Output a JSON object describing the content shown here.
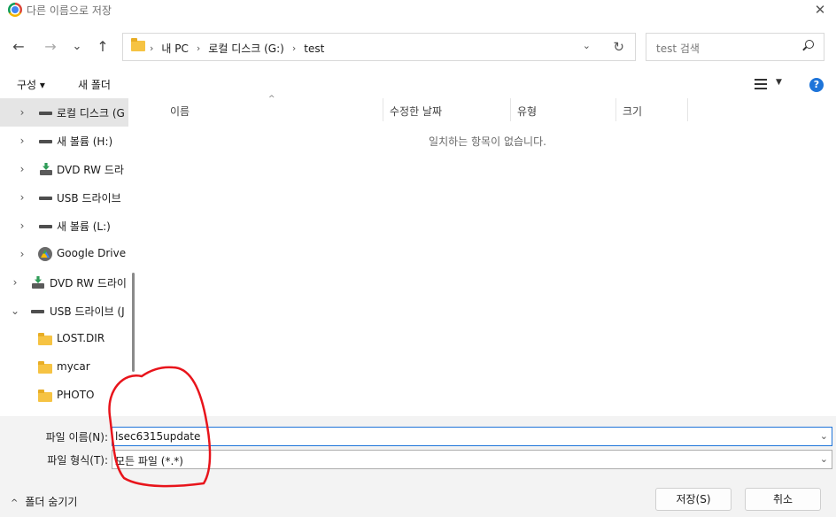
{
  "window": {
    "title": "다른 이름으로 저장",
    "close_glyph": "✕"
  },
  "toolbar": {
    "back_glyph": "←",
    "forward_glyph": "→",
    "recent_glyph": "⌄",
    "up_glyph": "↑"
  },
  "address": {
    "crumbs": [
      "내 PC",
      "로컬 디스크 (G:)",
      "test"
    ],
    "separator": "›",
    "dropdown_glyph": "⌄",
    "refresh_glyph": "↻"
  },
  "search": {
    "placeholder": "test 검색"
  },
  "commandbar": {
    "organize": "구성 ▾",
    "new_folder": "새 폴더",
    "help": "?"
  },
  "sidebar": {
    "items": [
      {
        "label": "로컬 디스크 (G",
        "icon": "drive-icon",
        "chevron": "›",
        "selected": true
      },
      {
        "label": "새 볼륨 (H:)",
        "icon": "drive-icon",
        "chevron": "›"
      },
      {
        "label": "DVD RW 드라",
        "icon": "dvd-icon",
        "chevron": "›"
      },
      {
        "label": "USB 드라이브",
        "icon": "drive-icon",
        "chevron": "›"
      },
      {
        "label": "새 볼륨 (L:)",
        "icon": "drive-icon",
        "chevron": "›"
      },
      {
        "label": "Google Drive (",
        "icon": "gdrive-icon",
        "chevron": "›"
      },
      {
        "label": "DVD RW 드라이",
        "icon": "dvd-icon",
        "chevron": "›"
      },
      {
        "label": "USB 드라이브 (J",
        "icon": "drive-icon",
        "chevron": "⌄"
      },
      {
        "label": "LOST.DIR",
        "icon": "folder-icon",
        "chevron": ""
      },
      {
        "label": "mycar",
        "icon": "folder-icon",
        "chevron": ""
      },
      {
        "label": "PHOTO",
        "icon": "folder-icon",
        "chevron": ""
      }
    ]
  },
  "filelist": {
    "columns": [
      "이름",
      "수정한 날짜",
      "유형",
      "크기"
    ],
    "sort_glyph": "^",
    "empty_message": "일치하는 항목이 없습니다."
  },
  "form": {
    "filename_label": "파일 이름(N):",
    "filename_value": "lsec6315update",
    "filetype_label": "파일 형식(T):",
    "filetype_value": "모든 파일 (*.*)",
    "dropdown_glyph": "⌄"
  },
  "footer": {
    "hide_folders": "폴더 숨기기",
    "hide_caret": "^",
    "save": "저장(S)",
    "cancel": "취소"
  },
  "colors": {
    "accent": "#1e74d9",
    "annotation": "#e8141b",
    "folder": "#f6c343"
  }
}
